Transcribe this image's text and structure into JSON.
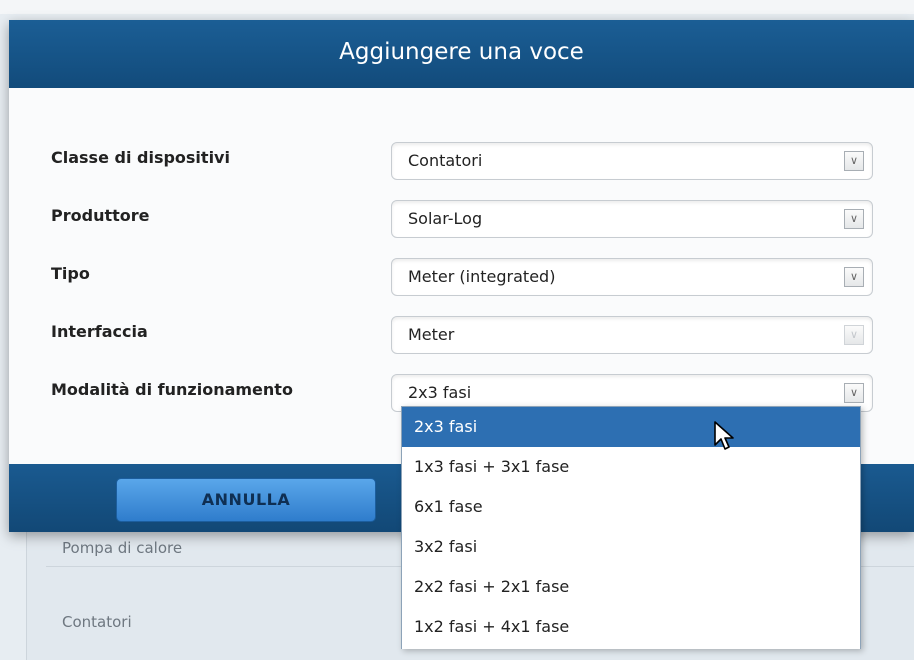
{
  "background": {
    "list_rows": [
      "Pompa di calore",
      "Contatori"
    ]
  },
  "modal": {
    "title": "Aggiungere una voce",
    "cancel_label": "ANNULLA",
    "fields": [
      {
        "label": "Classe di dispositivi",
        "value": "Contatori",
        "disabled": false
      },
      {
        "label": "Produttore",
        "value": "Solar-Log",
        "disabled": false
      },
      {
        "label": "Tipo",
        "value": "Meter (integrated)",
        "disabled": false
      },
      {
        "label": "Interfaccia",
        "value": "Meter",
        "disabled": true
      },
      {
        "label": "Modalità di funzionamento",
        "value": "2x3 fasi",
        "disabled": false
      }
    ]
  },
  "dropdown": {
    "selected_index": 0,
    "options": [
      "2x3 fasi",
      "1x3 fasi + 3x1 fase",
      "6x1 fase",
      "3x2 fasi",
      "2x2 fasi + 2x1 fase",
      "1x2 fasi + 4x1 fase"
    ]
  },
  "icons": {
    "select_arrow": "chevron-down-icon",
    "cursor": "mouse-pointer-icon"
  },
  "colors": {
    "header_blue": "#1b5e95",
    "selected_option": "#2d6fb2",
    "button_blue": "#4a97e0"
  }
}
